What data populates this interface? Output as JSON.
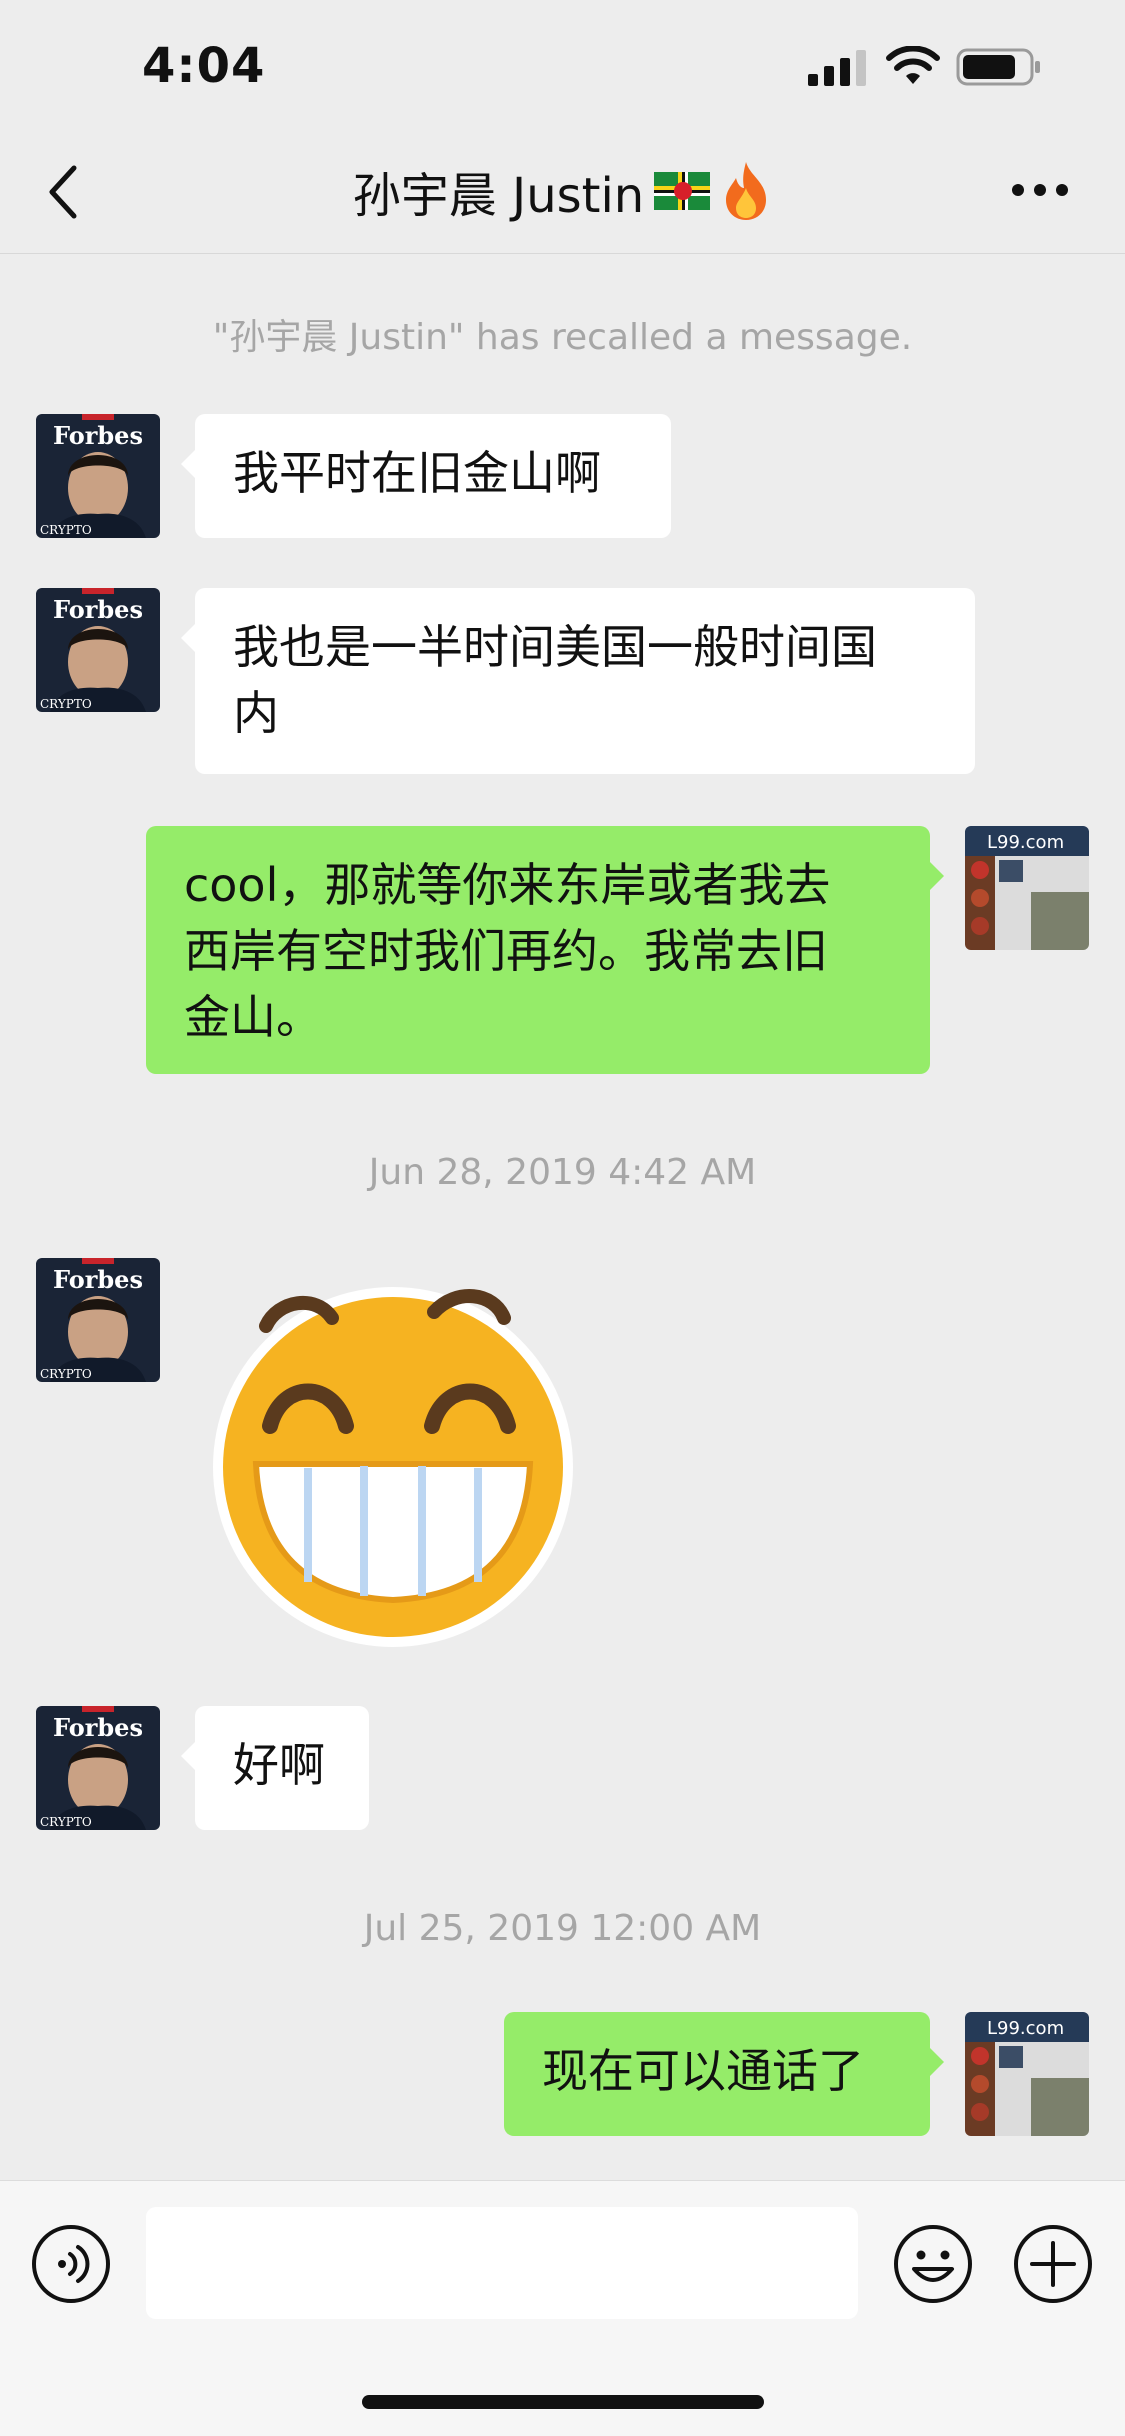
{
  "status_bar": {
    "time": "4:04",
    "signal_icon": "cellular-signal-icon",
    "wifi_icon": "wifi-icon",
    "battery_icon": "battery-icon"
  },
  "nav": {
    "back_icon": "chevron-left-icon",
    "title": "孙宇晨 Justin",
    "title_emojis": [
      "dominica-flag",
      "fire"
    ],
    "more_icon": "more-dots-icon"
  },
  "messages": {
    "recall_notice": "\"孙宇晨 Justin\" has recalled a message.",
    "m1": "我平时在旧金山啊",
    "m2_line1": "我也是一半时间美国一般时间国",
    "m2_line2": "内",
    "m3_line1": "cool，那就等你来东岸或者我去",
    "m3_line2": "西岸有空时我们再约。我常去旧",
    "m3_line3": "金山。",
    "timestamp1": "Jun 28, 2019 4:42 AM",
    "sticker": "grinning-face-sticker",
    "m5": "好啊",
    "timestamp2": "Jul 25, 2019 12:00 AM",
    "m6": "现在可以通话了"
  },
  "avatars": {
    "contact_cover_text": "Forbes",
    "contact_sub_text": "CRYPTO",
    "self_watermark": "L99.com"
  },
  "input_bar": {
    "voice_icon": "voice-icon",
    "text_value": "",
    "emoji_icon": "emoji-icon",
    "plus_icon": "plus-icon"
  },
  "colors": {
    "background": "#ededed",
    "incoming_bubble": "#ffffff",
    "outgoing_bubble": "#95ec69",
    "system_text": "#a6a6a6"
  }
}
